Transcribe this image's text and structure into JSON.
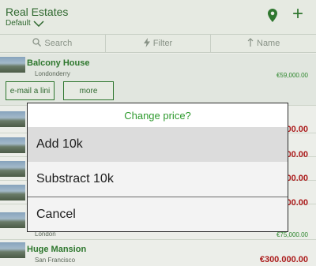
{
  "header": {
    "title": "Real Estates",
    "subtitle": "Default",
    "add_label": "+"
  },
  "toolbar": {
    "search_label": "Search",
    "filter_label": "Filter",
    "sort_label": "Name"
  },
  "listings": [
    {
      "name": "Balcony House",
      "location": "Londonderry",
      "price": "€59,000.00"
    },
    {
      "name": "",
      "location": "",
      "price": "000.00"
    },
    {
      "name": "",
      "location": "",
      "price": "000.00"
    },
    {
      "name": "",
      "location": "",
      "price": "000.00"
    },
    {
      "name": "",
      "location": "",
      "price": "000.00"
    },
    {
      "name": "",
      "location": "London",
      "price": "€75,000.00"
    },
    {
      "name": "Huge Mansion",
      "location": "San Francisco",
      "price": "€300.000.00"
    }
  ],
  "row_actions": {
    "email_label": "e-mail a lini",
    "more_label": "more"
  },
  "dialog": {
    "title": "Change price?",
    "options": [
      "Add 10k",
      "Substract 10k",
      "Cancel"
    ]
  },
  "colors": {
    "accent": "#2e9a2e",
    "price_red": "#b01a1a",
    "dialog_highlight": "#dcdcdc"
  }
}
